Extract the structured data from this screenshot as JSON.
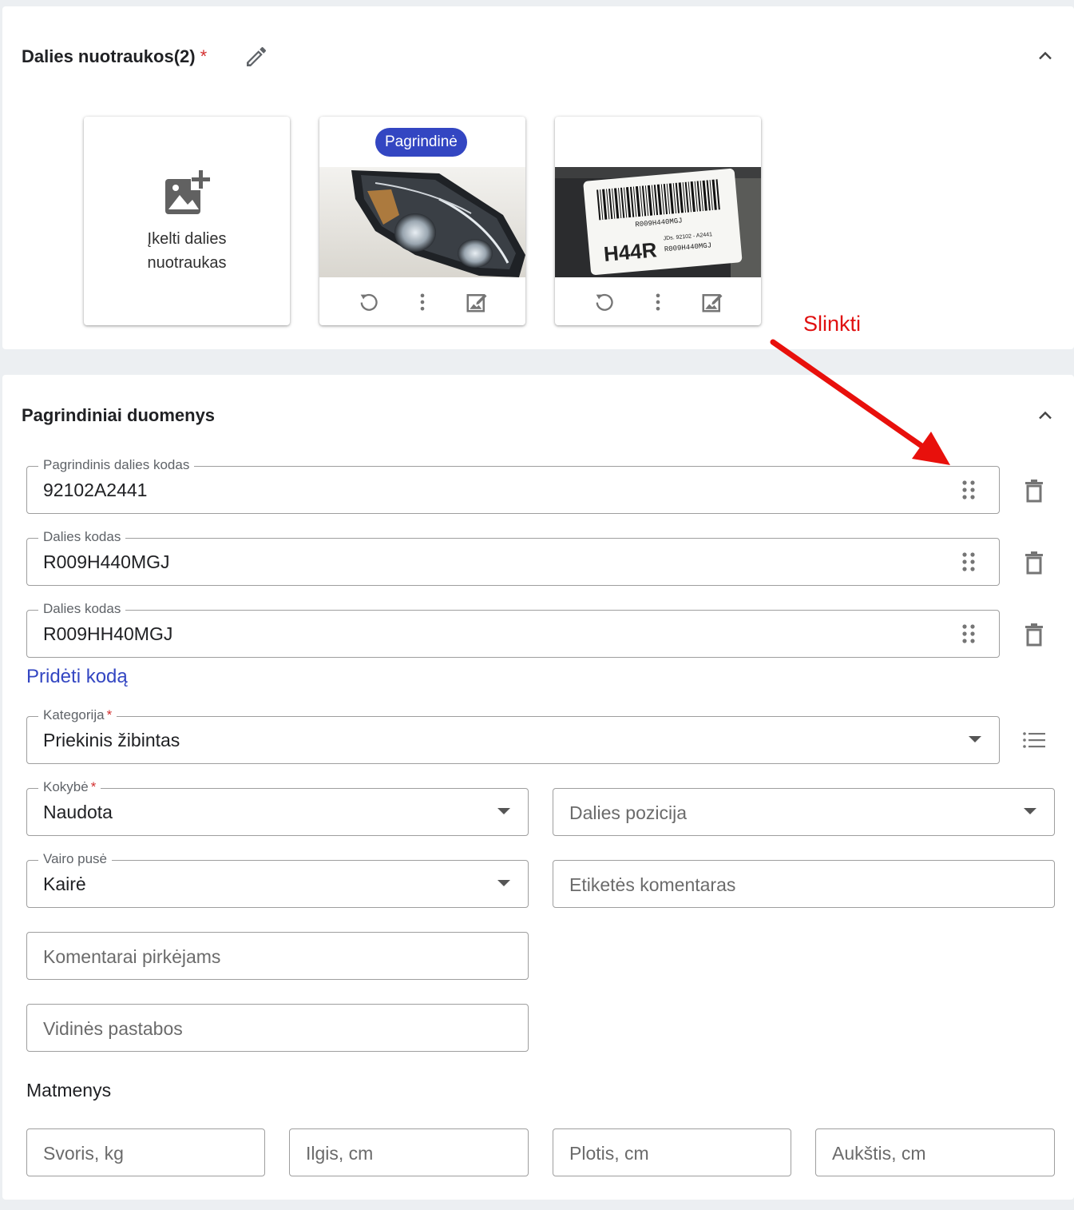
{
  "photos_section": {
    "title": "Dalies nuotraukos(2)",
    "required_mark": "*",
    "upload_label": "Įkelti dalies nuotraukas",
    "main_badge": "Pagrindinė",
    "photo_count": 2,
    "label_photo_text": {
      "barcode_line": "R009H440MGJ",
      "code_big": "H44R",
      "code_small_1": "JDs. 92102 - A2441",
      "code_small_2": "R009H440MGJ"
    }
  },
  "annotation": {
    "text": "Slinkti",
    "color": "#e01010"
  },
  "main_section": {
    "title": "Pagrindiniai duomenys",
    "part_codes": [
      {
        "label": "Pagrindinis dalies kodas",
        "value": "92102A2441"
      },
      {
        "label": "Dalies kodas",
        "value": "R009H440MGJ"
      },
      {
        "label": "Dalies kodas",
        "value": "R009HH40MGJ"
      }
    ],
    "add_code_link": "Pridėti kodą",
    "category": {
      "label": "Kategorija",
      "required_mark": "*",
      "value": "Priekinis žibintas"
    },
    "quality": {
      "label": "Kokybė",
      "required_mark": "*",
      "value": "Naudota"
    },
    "part_position": {
      "placeholder": "Dalies pozicija"
    },
    "steering_side": {
      "label": "Vairo pusė",
      "value": "Kairė"
    },
    "label_comment": {
      "placeholder": "Etiketės komentaras"
    },
    "buyer_comments": {
      "placeholder": "Komentarai pirkėjams"
    },
    "internal_notes": {
      "placeholder": "Vidinės pastabos"
    },
    "dimensions": {
      "title": "Matmenys",
      "weight": {
        "placeholder": "Svoris, kg"
      },
      "length": {
        "placeholder": "Ilgis, cm"
      },
      "width": {
        "placeholder": "Plotis, cm"
      },
      "height": {
        "placeholder": "Aukštis, cm"
      }
    }
  },
  "colors": {
    "accent": "#3346c2",
    "required": "#d32f2f",
    "background": "#eceff2"
  },
  "icons": [
    "edit-icon",
    "chevron-up-icon",
    "add-photo-icon",
    "rotate-icon",
    "more-vert-icon",
    "edit-photo-icon",
    "drag-handle-icon",
    "delete-icon",
    "list-icon",
    "dropdown-arrow-icon"
  ]
}
